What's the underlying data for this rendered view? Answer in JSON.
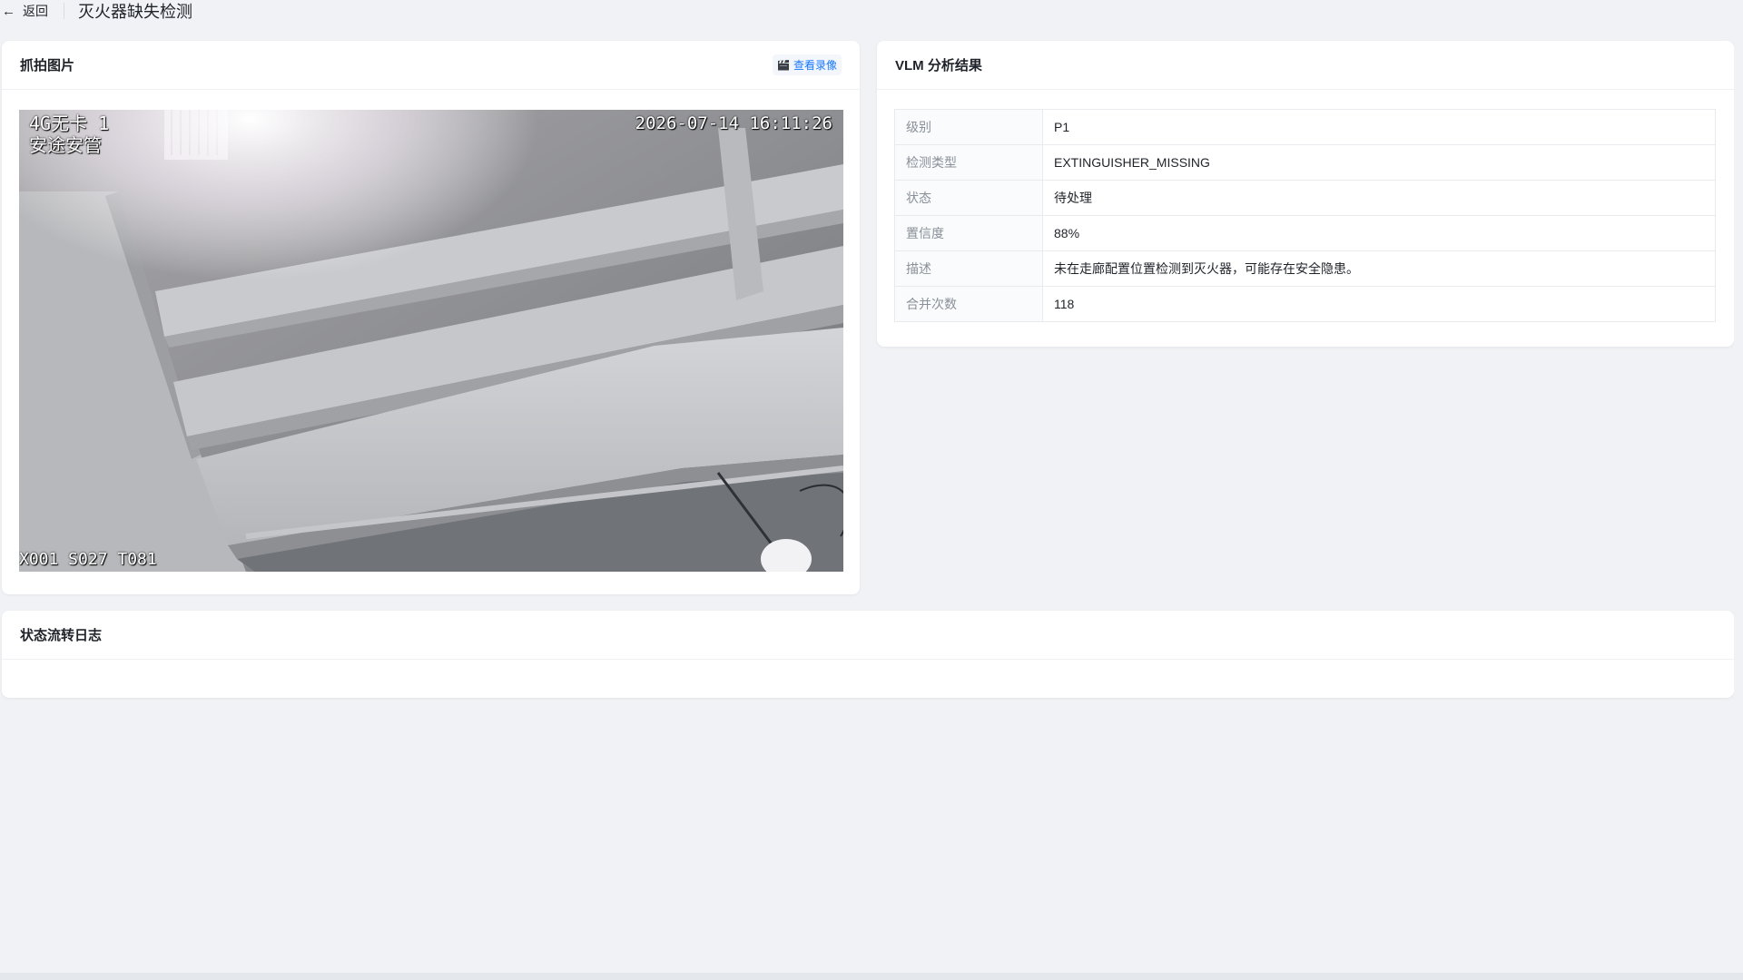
{
  "header": {
    "back_label": "返回",
    "page_title": "灭火器缺失检测"
  },
  "capture": {
    "title": "抓拍图片",
    "video_link_label": "查看录像",
    "video_icon": "clapper-icon",
    "osd": {
      "top_left_line1": "4G无卡 1",
      "top_left_line2": "安途安管",
      "timestamp": "2026-07-14 16:11:26",
      "bottom_left": "X001 S027 T081"
    }
  },
  "vlm": {
    "title": "VLM 分析结果",
    "rows": [
      {
        "key": "级别",
        "value": "P1"
      },
      {
        "key": "检测类型",
        "value": "EXTINGUISHER_MISSING"
      },
      {
        "key": "状态",
        "value": "待处理"
      },
      {
        "key": "置信度",
        "value": "88%"
      },
      {
        "key": "描述",
        "value": "未在走廊配置位置检测到灭火器，可能存在安全隐患。"
      },
      {
        "key": "合并次数",
        "value": "118"
      }
    ]
  },
  "log": {
    "title": "状态流转日志"
  },
  "colors": {
    "accent": "#1677ff",
    "background": "#f0f2f5",
    "card": "#ffffff"
  }
}
